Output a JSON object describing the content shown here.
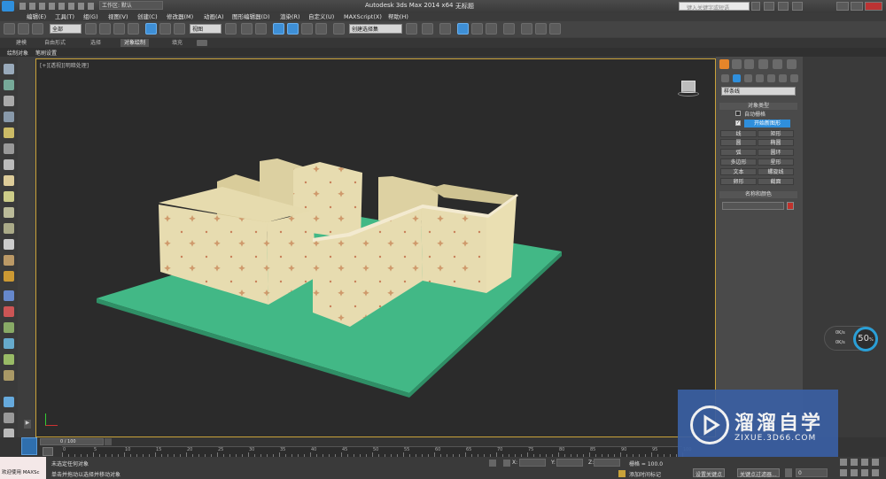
{
  "window": {
    "title": "Autodesk 3ds Max  2014 x64",
    "doc": "无标题",
    "workspace": "工作区: 默认",
    "search_placeholder": "键入关键字或短语"
  },
  "menu": [
    "编辑(E)",
    "工具(T)",
    "组(G)",
    "视图(V)",
    "创建(C)",
    "修改器(M)",
    "动画(A)",
    "图形编辑器(D)",
    "渲染(R)",
    "自定义(U)",
    "MAXScript(X)",
    "帮助(H)"
  ],
  "toolbar": {
    "filter": "全部",
    "coord": "视图",
    "selection_set": "创建选择集"
  },
  "ribbon": {
    "tabs": [
      "建模",
      "自由形式",
      "选择",
      "对象绘制",
      "填充"
    ],
    "active": "对象绘制",
    "sub": [
      "绘制对象",
      "笔刷设置"
    ]
  },
  "viewport": {
    "label": "[+][透视][明暗处理]"
  },
  "command_panel": {
    "category": "样条线",
    "object_type_header": "对象类型",
    "auto_grid": "自动栅格",
    "start_new_shape": "开始新图形",
    "buttons": [
      [
        "线",
        "矩形"
      ],
      [
        "圆",
        "椭圆"
      ],
      [
        "弧",
        "圆环"
      ],
      [
        "多边形",
        "星形"
      ],
      [
        "文本",
        "螺旋线"
      ],
      [
        "卵形",
        "截面"
      ]
    ],
    "name_color_header": "名称和颜色",
    "color": "#c0322c"
  },
  "timeline": {
    "frame": "0 / 100",
    "ticks": [
      "0",
      "5",
      "10",
      "15",
      "20",
      "25",
      "30",
      "35",
      "40",
      "45",
      "50",
      "55",
      "60",
      "65",
      "70",
      "75",
      "80",
      "85",
      "90",
      "95",
      "100"
    ]
  },
  "status": {
    "maxscript": "欢迎使用 MAXSc",
    "line1": "未选定任何对象",
    "line2": "单击并拖动以选择并移动对象",
    "x_label": "X:",
    "y_label": "Y:",
    "z_label": "Z:",
    "grid": "栅格 = 100.0",
    "add_tag": "添加时间标记",
    "set_key": "设置关键点",
    "key_filters": "关键点过滤器...",
    "frame_field": "0"
  },
  "hud": {
    "value": "50",
    "unit": "%",
    "rate1": "0K/s",
    "rate2": "0K/s"
  },
  "watermark": {
    "cn": "溜溜自学",
    "en": "ZIXUE.3D66.COM"
  },
  "colors": {
    "accent": "#2f8fdc",
    "selection_border": "#c9a23a",
    "floor": "#42b886",
    "wall": "#e7dcb0"
  }
}
